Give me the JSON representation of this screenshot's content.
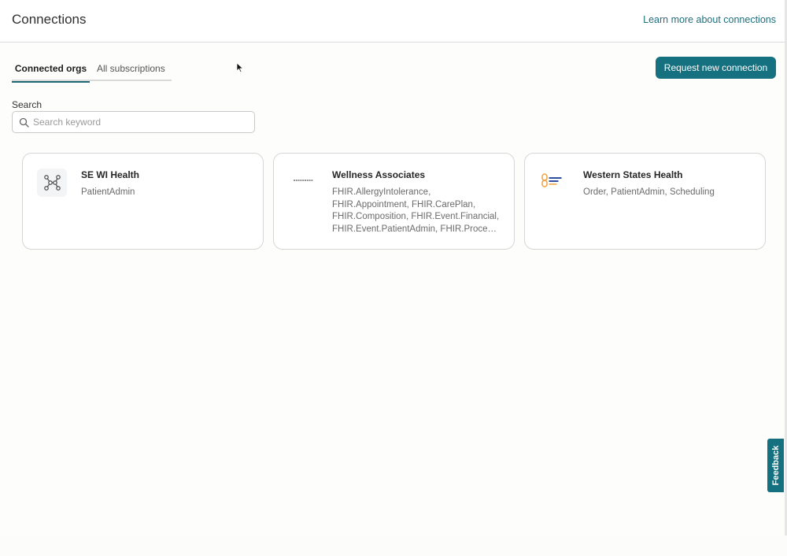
{
  "header": {
    "title": "Connections",
    "learn_more_link": "Learn more about connections"
  },
  "tabs": [
    {
      "label": "Connected orgs",
      "active": true
    },
    {
      "label": "All subscriptions",
      "active": false
    }
  ],
  "actions": {
    "request_button": "Request new connection"
  },
  "search": {
    "label": "Search",
    "placeholder": "Search keyword",
    "value": ""
  },
  "cards": [
    {
      "name": "SE WI Health",
      "logo": "network-graph-icon",
      "desc_lines": [
        "PatientAdmin"
      ]
    },
    {
      "name": "Wellness Associates",
      "logo": "wellness-associates-logo",
      "desc_lines": [
        "FHIR.AllergyIntolerance,",
        "FHIR.Appointment, FHIR.CarePlan,",
        "FHIR.Composition, FHIR.Event.Financial,",
        "FHIR.Event.PatientAdmin, FHIR.Procedure, FHIR.Schedule"
      ]
    },
    {
      "name": "Western States Health",
      "logo": "western-states-health-logo",
      "desc_lines": [
        "Order, PatientAdmin, Scheduling"
      ]
    }
  ],
  "feedback": {
    "label": "Feedback"
  },
  "colors": {
    "accent": "#15707f",
    "link": "#1f6f7d",
    "logo_orange": "#f0a64a",
    "logo_blue": "#2b4f9e"
  }
}
